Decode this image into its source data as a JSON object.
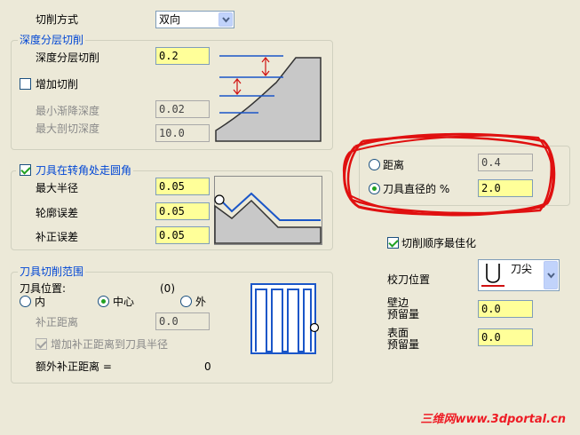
{
  "cut_method": {
    "label": "切削方式",
    "value": "双向"
  },
  "depth_group": {
    "title": "深度分层切削",
    "depth_label": "深度分层切削",
    "depth_value": "0.2",
    "add_cut_label": "增加切削",
    "add_cut_checked": false,
    "min_step_label": "最小渐降深度",
    "min_step_value": "0.02",
    "max_cut_label": "最大剖切深度",
    "max_cut_value": "10.0"
  },
  "corner_group": {
    "title": "刀具在转角处走圆角",
    "checked": true,
    "max_radius_label": "最大半径",
    "max_radius_value": "0.05",
    "contour_tol_label": "轮廓误差",
    "contour_tol_value": "0.05",
    "comp_tol_label": "补正误差",
    "comp_tol_value": "0.05"
  },
  "range_group": {
    "title": "刀具切削范围",
    "tool_pos_label": "刀具位置:",
    "tool_pos_value": "(0)",
    "options": [
      "内",
      "中心",
      "外"
    ],
    "selected_index": 1,
    "comp_dist_label": "补正距离",
    "comp_dist_value": "0.0",
    "add_comp_label": "增加补正距离到刀具半径",
    "add_comp_checked": true,
    "extra_comp_label": "额外补正距离 =",
    "extra_comp_value": "0"
  },
  "lift_group": {
    "distance_label": "距离",
    "distance_value": "0.4",
    "dia_pct_label": "刀具直径的 %",
    "dia_pct_value": "2.0",
    "selected": "dia_pct"
  },
  "optimize": {
    "label": "切削顺序最佳化",
    "checked": true
  },
  "tool_pos": {
    "label": "校刀位置",
    "value": "刀尖"
  },
  "wall_stock": {
    "label_line1": "壁边",
    "label_line2": "预留量",
    "value": "0.0"
  },
  "floor_stock": {
    "label_line1": "表面",
    "label_line2": "预留量",
    "value": "0.0"
  },
  "watermark": "三维网www.3dportal.cn",
  "colors": {
    "field_bg": "#ffff99",
    "group_title": "#0046d5",
    "annotation_red": "#e01010",
    "watermark": "#ee1c25"
  }
}
